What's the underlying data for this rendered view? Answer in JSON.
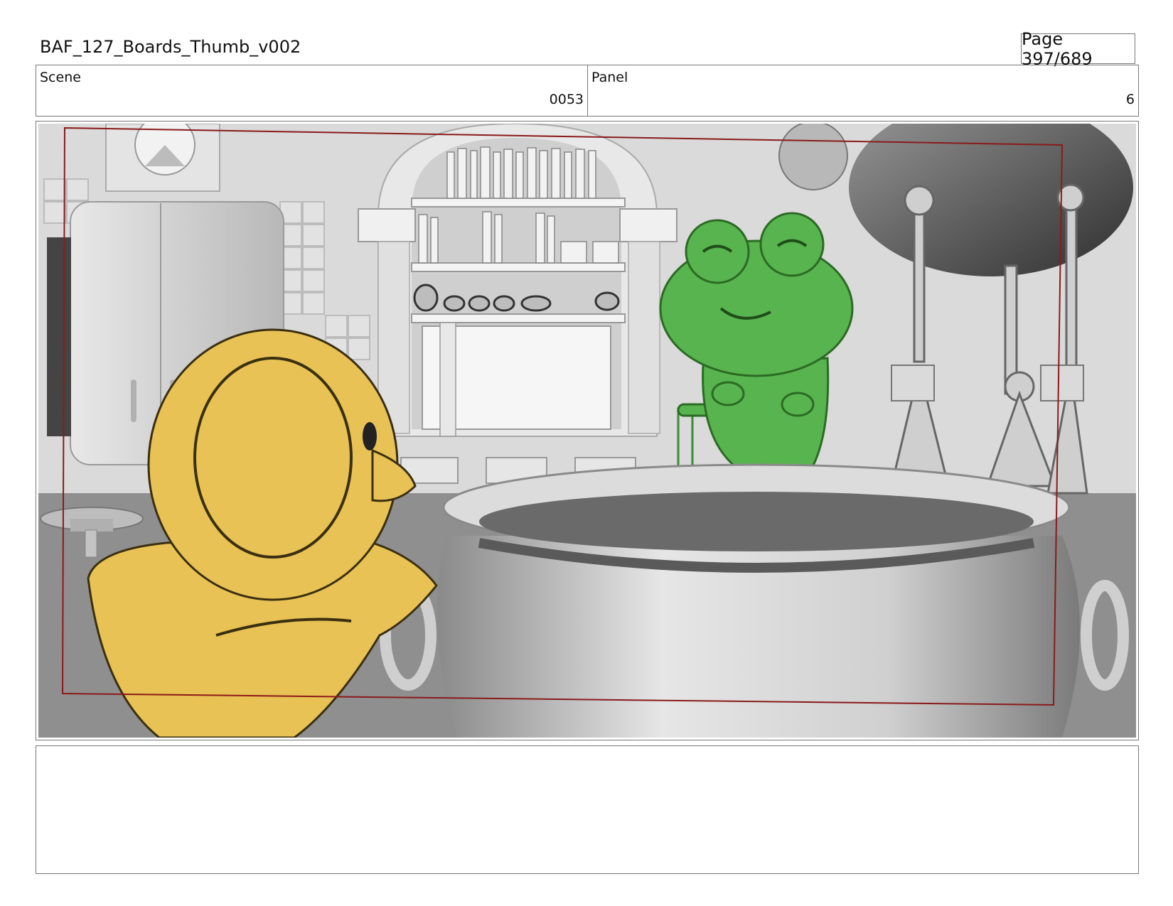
{
  "header": {
    "document_title": "BAF_127_Boards_Thumb_v002",
    "page_label": "Page 397/689"
  },
  "info": {
    "scene_label": "Scene",
    "scene_value": "0053",
    "panel_label": "Panel",
    "panel_value": "6"
  },
  "colors": {
    "duck": "#E8C255",
    "frog": "#58B44E",
    "safe_frame": "#8B1A1A",
    "render_grey": "#D6D6D6"
  },
  "notes": {
    "text": ""
  }
}
